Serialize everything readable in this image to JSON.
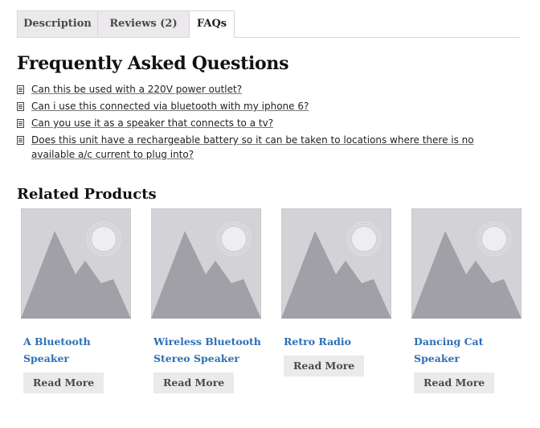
{
  "tabs": [
    {
      "label": "Description",
      "active": false
    },
    {
      "label": "Reviews (2)",
      "active": false
    },
    {
      "label": "FAQs",
      "active": true
    }
  ],
  "faq": {
    "title": "Frequently Asked Questions",
    "questions": [
      "Can this be used with a 220V power outlet?",
      "Can i use this connected via bluetooth with my iphone 6?",
      "Can you use it as a speaker that connects to a tv?",
      "Does this unit have a rechargeable battery so it can be taken to locations where there is no available a/c current to plug into?"
    ]
  },
  "related": {
    "title": "Related Products",
    "products": [
      {
        "name": "A Bluetooth Speaker",
        "button": "Read More"
      },
      {
        "name": "Wireless Bluetooth Stereo Speaker",
        "button": "Read More"
      },
      {
        "name": "Retro Radio",
        "button": "Read More"
      },
      {
        "name": "Dancing Cat Speaker",
        "button": "Read More"
      }
    ]
  },
  "colors": {
    "link_blue": "#2e6fb5",
    "tab_bg": "#ebe9eb",
    "placeholder_bg": "#d3d2d6",
    "placeholder_mountain": "#a1a0a6"
  },
  "icons": {
    "faq_item": "document-icon",
    "product_image": "image-placeholder-icon"
  }
}
